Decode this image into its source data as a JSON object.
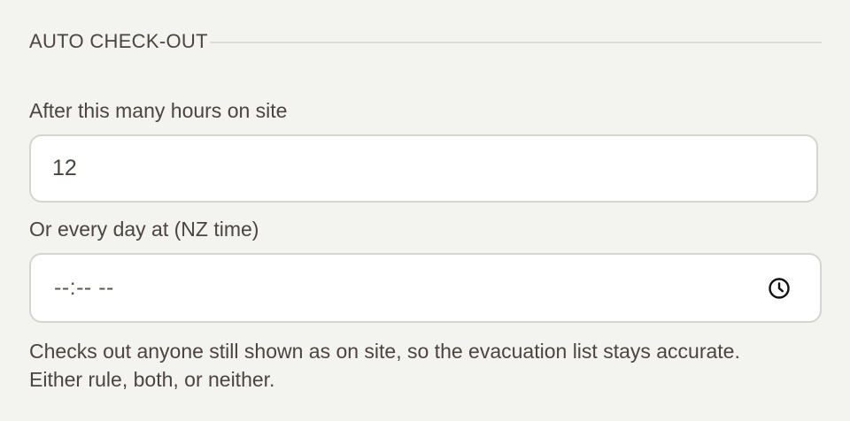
{
  "section": {
    "title": "AUTO CHECK-OUT"
  },
  "hours_field": {
    "label": "After this many hours on site",
    "value": "12"
  },
  "time_field": {
    "label": "Or every day at (NZ time)",
    "placeholder": "--:-- --",
    "icon": "clock-icon"
  },
  "help": {
    "line1": "Checks out anyone still shown as on site, so the evacuation list stays accurate.",
    "line2": "Either rule, both, or neither."
  }
}
